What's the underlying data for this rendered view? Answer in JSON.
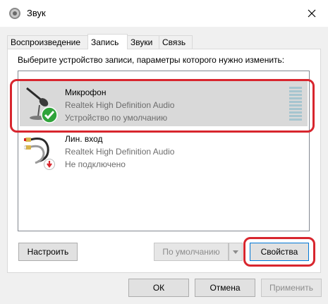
{
  "window": {
    "title": "Звук",
    "icon": "speaker-icon"
  },
  "tabs": [
    {
      "label": "Воспроизведение",
      "active": false
    },
    {
      "label": "Запись",
      "active": true
    },
    {
      "label": "Звуки",
      "active": false
    },
    {
      "label": "Связь",
      "active": false
    }
  ],
  "instruction": "Выберите устройство записи, параметры которого нужно изменить:",
  "devices": [
    {
      "name": "Микрофон",
      "driver": "Realtek High Definition Audio",
      "status": "Устройство по умолчанию",
      "icon": "microphone-icon",
      "badge": "default-check-icon",
      "selected": true,
      "level": 0
    },
    {
      "name": "Лин. вход",
      "driver": "Realtek High Definition Audio",
      "status": "Не подключено",
      "icon": "line-in-icon",
      "badge": "not-connected-icon",
      "selected": false
    }
  ],
  "buttons": {
    "configure": "Настроить",
    "set_default": "По умолчанию",
    "properties": "Свойства",
    "ok": "ОК",
    "cancel": "Отмена",
    "apply": "Применить"
  },
  "colors": {
    "highlight": "#d8262e",
    "selected_row": "#d9d9d9",
    "meter": "#a6c5cf",
    "check_green": "#2fa33a",
    "arrow_red": "#d9262e"
  }
}
